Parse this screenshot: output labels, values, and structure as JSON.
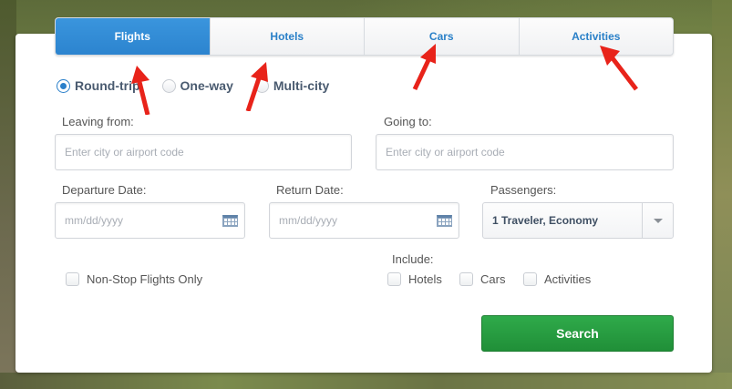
{
  "tabs": [
    {
      "label": "Flights",
      "active": true
    },
    {
      "label": "Hotels",
      "active": false
    },
    {
      "label": "Cars",
      "active": false
    },
    {
      "label": "Activities",
      "active": false
    }
  ],
  "trip_type": {
    "options": [
      "Round-trip",
      "One-way",
      "Multi-city"
    ],
    "selected": "Round-trip"
  },
  "leaving_from": {
    "label": "Leaving from:",
    "placeholder": "Enter city or airport code"
  },
  "going_to": {
    "label": "Going to:",
    "placeholder": "Enter city or airport code"
  },
  "departure": {
    "label": "Departure Date:",
    "placeholder": "mm/dd/yyyy"
  },
  "return": {
    "label": "Return Date:",
    "placeholder": "mm/dd/yyyy"
  },
  "passengers": {
    "label": "Passengers:",
    "value": "1 Traveler, Economy"
  },
  "nonstop": {
    "label": "Non-Stop Flights Only",
    "checked": false
  },
  "include": {
    "label": "Include:",
    "options": [
      {
        "label": "Hotels",
        "checked": false
      },
      {
        "label": "Cars",
        "checked": false
      },
      {
        "label": "Activities",
        "checked": false
      }
    ]
  },
  "search_label": "Search",
  "colors": {
    "accent": "#2c84cf",
    "search": "#27a043",
    "annotation_arrow": "#e8231a"
  }
}
